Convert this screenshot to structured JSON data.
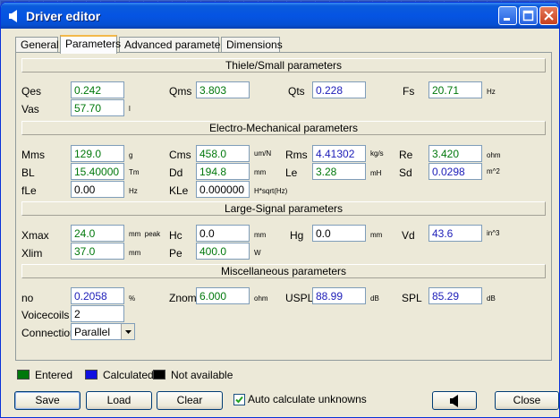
{
  "window": {
    "title": "Driver editor"
  },
  "tabs": [
    "General",
    "Parameters",
    "Advanced parameters",
    "Dimensions"
  ],
  "sections": {
    "ts": "Thiele/Small parameters",
    "em": "Electro-Mechanical parameters",
    "ls": "Large-Signal parameters",
    "misc": "Miscellaneous parameters"
  },
  "params": {
    "qes": {
      "label": "Qes",
      "value": "0.242",
      "unit": ""
    },
    "qms": {
      "label": "Qms",
      "value": "3.803",
      "unit": ""
    },
    "qts": {
      "label": "Qts",
      "value": "0.228",
      "unit": ""
    },
    "fs": {
      "label": "Fs",
      "value": "20.71",
      "unit": "Hz"
    },
    "vas": {
      "label": "Vas",
      "value": "57.70",
      "unit": "l"
    },
    "mms": {
      "label": "Mms",
      "value": "129.0",
      "unit": "g"
    },
    "cms": {
      "label": "Cms",
      "value": "458.0",
      "unit": "um/N"
    },
    "rms": {
      "label": "Rms",
      "value": "4.41302",
      "unit": "kg/s"
    },
    "re": {
      "label": "Re",
      "value": "3.420",
      "unit": "ohm"
    },
    "bl": {
      "label": "BL",
      "value": "15.40000",
      "unit": "Tm"
    },
    "dd": {
      "label": "Dd",
      "value": "194.8",
      "unit": "mm"
    },
    "le": {
      "label": "Le",
      "value": "3.28",
      "unit": "mH"
    },
    "sd": {
      "label": "Sd",
      "value": "0.0298",
      "unit": "m^2"
    },
    "fle": {
      "label": "fLe",
      "value": "0.00",
      "unit": "Hz"
    },
    "kle": {
      "label": "KLe",
      "value": "0.000000",
      "unit": "H*sqrt(Hz)"
    },
    "xmax": {
      "label": "Xmax",
      "value": "24.0",
      "unit": "mm  peak"
    },
    "hc": {
      "label": "Hc",
      "value": "0.0",
      "unit": "mm"
    },
    "hg": {
      "label": "Hg",
      "value": "0.0",
      "unit": "mm"
    },
    "vd": {
      "label": "Vd",
      "value": "43.6",
      "unit": "in^3"
    },
    "xlim": {
      "label": "Xlim",
      "value": "37.0",
      "unit": "mm"
    },
    "pe": {
      "label": "Pe",
      "value": "400.0",
      "unit": "W"
    },
    "no": {
      "label": "no",
      "value": "0.2058",
      "unit": "%"
    },
    "znom": {
      "label": "Znom",
      "value": "6.000",
      "unit": "ohm"
    },
    "uspl": {
      "label": "USPL",
      "value": "88.99",
      "unit": "dB"
    },
    "spl": {
      "label": "SPL",
      "value": "85.29",
      "unit": "dB"
    },
    "voicecoils": {
      "label": "Voicecoils",
      "value": "2"
    },
    "connection": {
      "label": "Connection",
      "value": "Parallel"
    }
  },
  "legend": {
    "entered": "Entered",
    "calculated": "Calculated",
    "unavailable": "Not available",
    "colors": {
      "entered": "#00780b",
      "calculated": "#1010e0",
      "unavailable": "#000000"
    }
  },
  "buttons": {
    "save": "Save",
    "load": "Load",
    "clear": "Clear",
    "close": "Close"
  },
  "auto_calc": {
    "label": "Auto calculate unknowns",
    "checked": true
  }
}
